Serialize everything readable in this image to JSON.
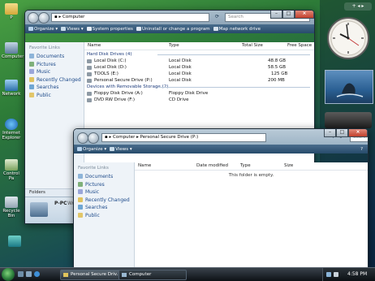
{
  "desktop": {
    "icons": [
      {
        "label": "P"
      },
      {
        "label": "Computer"
      },
      {
        "label": "Network"
      },
      {
        "label": "Internet Explorer"
      },
      {
        "label": "Control Pa"
      },
      {
        "label": "Recycle Bin"
      }
    ]
  },
  "window_back": {
    "address": "Computer",
    "search_placeholder": "Search",
    "toolbar": [
      "Organize",
      "Views",
      "System properties",
      "Uninstall or change a program",
      "Map network drive"
    ],
    "favorites_title": "Favorite Links",
    "favorites": [
      "Documents",
      "Pictures",
      "Music",
      "Recently Changed",
      "Searches",
      "Public"
    ],
    "folders_label": "Folders",
    "details_name": "P-PC",
    "details_more": "Wo",
    "columns": [
      "Name",
      "Type",
      "Total Size",
      "Free Space"
    ],
    "groups": [
      {
        "title": "Hard Disk Drives (4)",
        "items": [
          {
            "name": "Local Disk (C:)",
            "type": "Local Disk",
            "total": "48.8 GB",
            "free": ""
          },
          {
            "name": "Local Disk (D:)",
            "type": "Local Disk",
            "total": "58.5 GB",
            "free": ""
          },
          {
            "name": "TOOLS (E:)",
            "type": "Local Disk",
            "total": "125 GB",
            "free": ""
          },
          {
            "name": "Personal Secure Drive (P:)",
            "type": "Local Disk",
            "total": "200 MB",
            "free": ""
          }
        ]
      },
      {
        "title": "Devices with Removable Storage (2)",
        "items": [
          {
            "name": "Floppy Disk Drive (A:)",
            "type": "Floppy Disk Drive",
            "total": "",
            "free": ""
          },
          {
            "name": "DVD RW Drive (F:)",
            "type": "CD Drive",
            "total": "",
            "free": ""
          }
        ]
      }
    ]
  },
  "window_front": {
    "address_root": "Computer",
    "address_leaf": "Personal Secure Drive (P:)",
    "search_placeholder": "Search",
    "toolbar": [
      "Organize",
      "Views"
    ],
    "favorites_title": "Favorite Links",
    "favorites": [
      "Documents",
      "Pictures",
      "Music",
      "Recently Changed",
      "Searches",
      "Public"
    ],
    "columns": [
      "Name",
      "Date modified",
      "Type",
      "Size"
    ],
    "empty_message": "This folder is empty."
  },
  "taskbar": {
    "buttons": [
      "Personal Secure Driv...",
      "Computer"
    ],
    "clock": "4:58 PM"
  },
  "colors": {
    "toolbar": "#274b6b",
    "link": "#1d4a8a",
    "close": "#c2402c"
  }
}
